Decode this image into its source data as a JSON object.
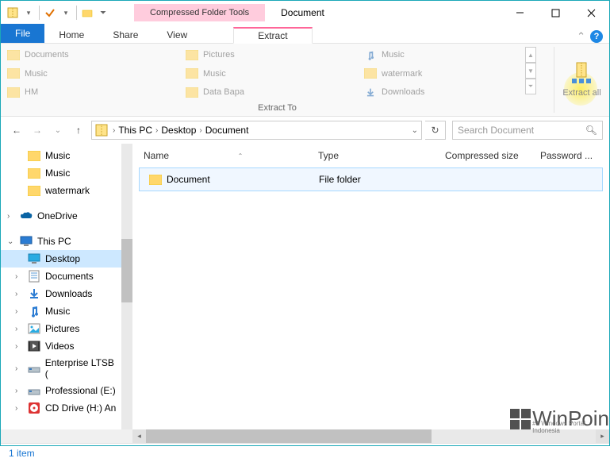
{
  "title": "Document",
  "context_tab": "Compressed Folder Tools",
  "tabs": {
    "file": "File",
    "home": "Home",
    "share": "Share",
    "view": "View",
    "extract": "Extract"
  },
  "ribbon": {
    "destinations": [
      [
        "Documents",
        "Pictures",
        "Music"
      ],
      [
        "Music",
        "Music",
        "watermark"
      ],
      [
        "HM",
        "Data Bapa",
        "Downloads"
      ]
    ],
    "group_label": "Extract To",
    "extract_all": "Extract all"
  },
  "breadcrumb": [
    "This PC",
    "Desktop",
    "Document"
  ],
  "search_placeholder": "Search Document",
  "tree": [
    {
      "label": "Music",
      "indent": 1,
      "icon": "folder"
    },
    {
      "label": "Music",
      "indent": 1,
      "icon": "folder"
    },
    {
      "label": "watermark",
      "indent": 1,
      "icon": "folder"
    },
    {
      "label": "",
      "indent": 0,
      "icon": "spacer"
    },
    {
      "label": "OneDrive",
      "indent": 0,
      "icon": "onedrive",
      "toggle": ">"
    },
    {
      "label": "",
      "indent": 0,
      "icon": "spacer"
    },
    {
      "label": "This PC",
      "indent": 0,
      "icon": "thispc",
      "toggle": "v"
    },
    {
      "label": "Desktop",
      "indent": 1,
      "icon": "desktop",
      "selected": true
    },
    {
      "label": "Documents",
      "indent": 1,
      "icon": "documents",
      "toggle": ">"
    },
    {
      "label": "Downloads",
      "indent": 1,
      "icon": "downloads",
      "toggle": ">"
    },
    {
      "label": "Music",
      "indent": 1,
      "icon": "music",
      "toggle": ">"
    },
    {
      "label": "Pictures",
      "indent": 1,
      "icon": "pictures",
      "toggle": ">"
    },
    {
      "label": "Videos",
      "indent": 1,
      "icon": "videos",
      "toggle": ">"
    },
    {
      "label": "Enterprise LTSB (",
      "indent": 1,
      "icon": "drive",
      "toggle": ">"
    },
    {
      "label": "Professional (E:)",
      "indent": 1,
      "icon": "drive",
      "toggle": ">"
    },
    {
      "label": "CD Drive (H:) An",
      "indent": 1,
      "icon": "cddrive",
      "toggle": ">"
    }
  ],
  "columns": {
    "name": "Name",
    "type": "Type",
    "size": "Compressed size",
    "pwd": "Password ..."
  },
  "rows": [
    {
      "name": "Document",
      "type": "File folder",
      "size": "",
      "pwd": ""
    }
  ],
  "status": "1 item",
  "watermark": {
    "text": "WinPoin",
    "sub": "#1 Windows Portal Indonesia"
  }
}
